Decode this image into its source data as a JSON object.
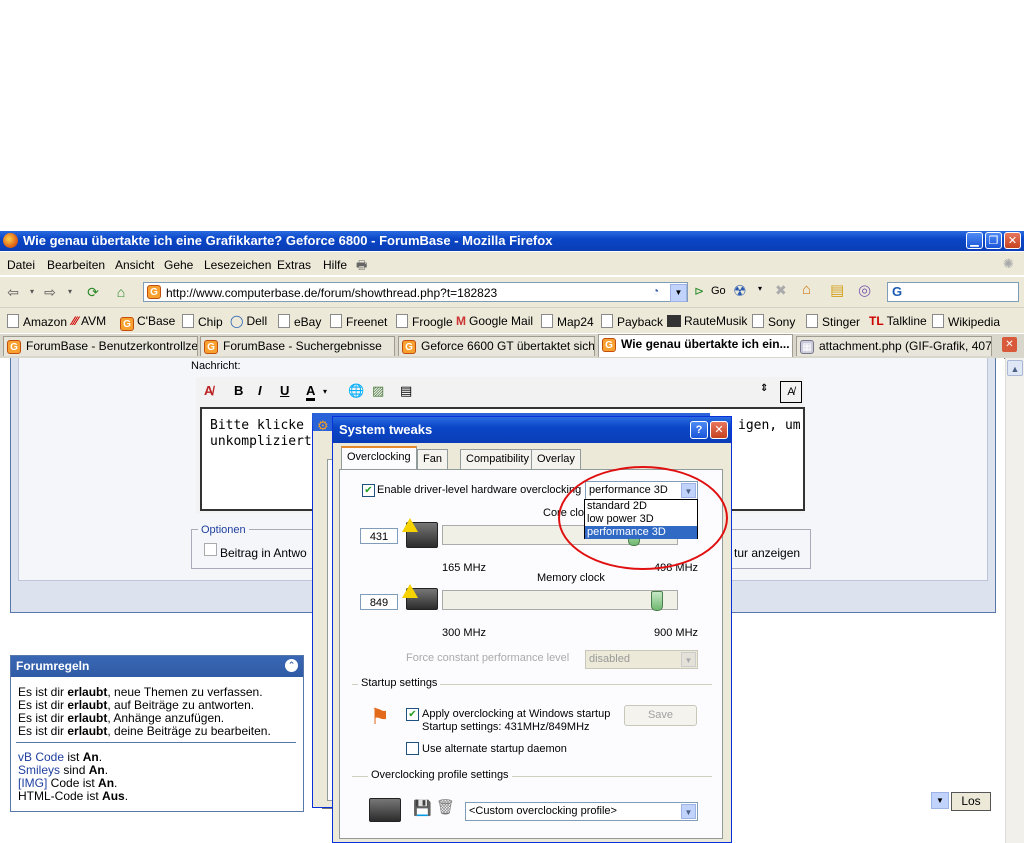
{
  "window": {
    "title": "Wie genau übertakte ich eine Grafikkarte? Geforce 6800 - ForumBase - Mozilla Firefox"
  },
  "menubar": [
    "Datei",
    "Bearbeiten",
    "Ansicht",
    "Gehe",
    "Lesezeichen",
    "Extras",
    "Hilfe"
  ],
  "navbar": {
    "url": "http://www.computerbase.de/forum/showthread.php?t=182823",
    "go_label": "Go"
  },
  "bookmarks": [
    "Amazon",
    "AVM",
    "C'Base",
    "Chip",
    "Dell",
    "eBay",
    "Freenet",
    "Froogle",
    "Google Mail",
    "Map24",
    "Payback",
    "RauteMusik",
    "Sony",
    "Stinger",
    "Talkline",
    "Wikipedia"
  ],
  "tabs": [
    "ForumBase - Benutzerkontrollzen...",
    "ForumBase - Suchergebnisse",
    "Geforce 6600 GT übertaktet sich ...",
    "Wie genau übertakte ich ein...",
    "attachment.php (GIF-Grafik, 407..."
  ],
  "editor": {
    "label": "Nachricht:",
    "text_line1": "Bitte klicke auf",
    "text_line1_end": "igen, um",
    "text_line2": "unkompliziert di",
    "options_legend": "Optionen",
    "option_left": "Beitrag in Antwo",
    "option_right": "tur anzeigen",
    "submit_label": "Los"
  },
  "rules": {
    "title": "Forumregeln",
    "lines": [
      {
        "pre": "Es ist dir ",
        "bold": "erlaubt",
        "post": ", neue Themen zu verfassen."
      },
      {
        "pre": "Es ist dir ",
        "bold": "erlaubt",
        "post": ", auf Beiträge zu antworten."
      },
      {
        "pre": "Es ist dir ",
        "bold": "erlaubt",
        "post": ", Anhänge anzufügen."
      },
      {
        "pre": "Es ist dir ",
        "bold": "erlaubt",
        "post": ", deine Beiträge zu bearbeiten."
      }
    ],
    "codes": [
      {
        "link": "vB Code",
        "mid": " ist ",
        "val": "An",
        "end": "."
      },
      {
        "link": "Smileys",
        "mid": " sind ",
        "val": "An",
        "end": "."
      },
      {
        "link": "[IMG]",
        "mid": " Code ist ",
        "val": "An",
        "end": "."
      },
      {
        "link": "",
        "mid": "HTML-Code ist ",
        "val": "Aus",
        "end": "."
      }
    ]
  },
  "dialog": {
    "title": "System tweaks",
    "tabs": [
      "Overclocking",
      "Fan",
      "Compatibility",
      "Overlay"
    ],
    "enable_label": "Enable driver-level hardware overclocking",
    "enable_checked": true,
    "mode_selected": "performance 3D",
    "mode_options": [
      "standard 2D",
      "low power 3D",
      "performance 3D"
    ],
    "core": {
      "label": "Core clock",
      "value": "431",
      "min": "165 MHz",
      "max": "498 MHz"
    },
    "memory": {
      "label": "Memory clock",
      "value": "849",
      "min": "300 MHz",
      "max": "900 MHz"
    },
    "force_label": "Force constant performance level",
    "force_value": "disabled",
    "startup": {
      "legend": "Startup settings",
      "apply_label": "Apply overclocking at Windows startup",
      "settings_text": "Startup settings: 431MHz/849MHz",
      "save_label": "Save",
      "alt_daemon_label": "Use alternate startup daemon"
    },
    "profile": {
      "legend": "Overclocking profile settings",
      "value": "<Custom overclocking profile>"
    }
  }
}
